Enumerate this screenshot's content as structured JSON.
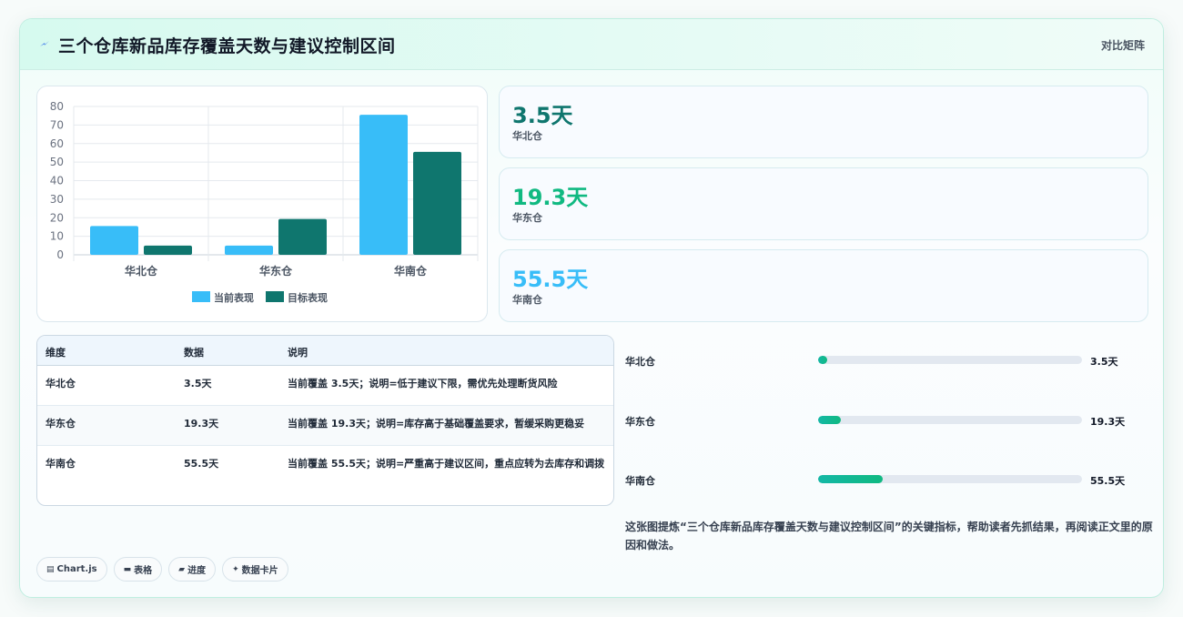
{
  "header": {
    "title": "三个仓库新品库存覆盖天数与建议控制区间",
    "mode_label": "对比矩阵"
  },
  "colors": {
    "current_bar": "#38bdf8",
    "target_bar": "#0f766e",
    "kpi_north": "#0f766e",
    "kpi_east": "#10b981",
    "kpi_south": "#38bdf8"
  },
  "chart_data": {
    "type": "bar",
    "categories": [
      "华北仓",
      "华东仓",
      "华南仓"
    ],
    "series": [
      {
        "name": "当前表现",
        "values": [
          15.5,
          5,
          75.5
        ]
      },
      {
        "name": "目标表现",
        "values": [
          5,
          19.3,
          55.5
        ]
      }
    ],
    "ylim": [
      0,
      80
    ],
    "yticks": [
      0,
      10,
      20,
      30,
      40,
      50,
      60,
      70,
      80
    ],
    "grid": true,
    "legend": "bottom"
  },
  "kpis": [
    {
      "value": "3.5天",
      "label": "华北仓"
    },
    {
      "value": "19.3天",
      "label": "华东仓"
    },
    {
      "value": "55.5天",
      "label": "华南仓"
    }
  ],
  "table": {
    "headers": [
      "维度",
      "数据",
      "说明"
    ],
    "rows": [
      {
        "dim": "华北仓",
        "data": "3.5天",
        "desc": "当前覆盖 3.5天；说明=低于建议下限，需优先处理断货风险"
      },
      {
        "dim": "华东仓",
        "data": "19.3天",
        "desc": "当前覆盖 19.3天；说明=库存高于基础覆盖要求，暂缓采购更稳妥"
      },
      {
        "dim": "华南仓",
        "data": "55.5天",
        "desc": "当前覆盖 55.5天；说明=严重高于建议区间，重点应转为去库存和调拨"
      }
    ]
  },
  "progress": [
    {
      "name": "华北仓",
      "value_label": "3.5天",
      "fraction": 0.035
    },
    {
      "name": "华东仓",
      "value_label": "19.3天",
      "fraction": 0.085
    },
    {
      "name": "华南仓",
      "value_label": "55.5天",
      "fraction": 0.245
    }
  ],
  "summary": "这张图提炼“三个仓库新品库存覆盖天数与建议控制区间”的关键指标，帮助读者先抓结果，再阅读正文里的原因和做法。",
  "chips": [
    {
      "icon": "chart-icon",
      "label": "Chart.js"
    },
    {
      "icon": "table-icon",
      "label": "表格"
    },
    {
      "icon": "progress-icon",
      "label": "进度"
    },
    {
      "icon": "sparkle-icon",
      "label": "数据卡片"
    }
  ]
}
